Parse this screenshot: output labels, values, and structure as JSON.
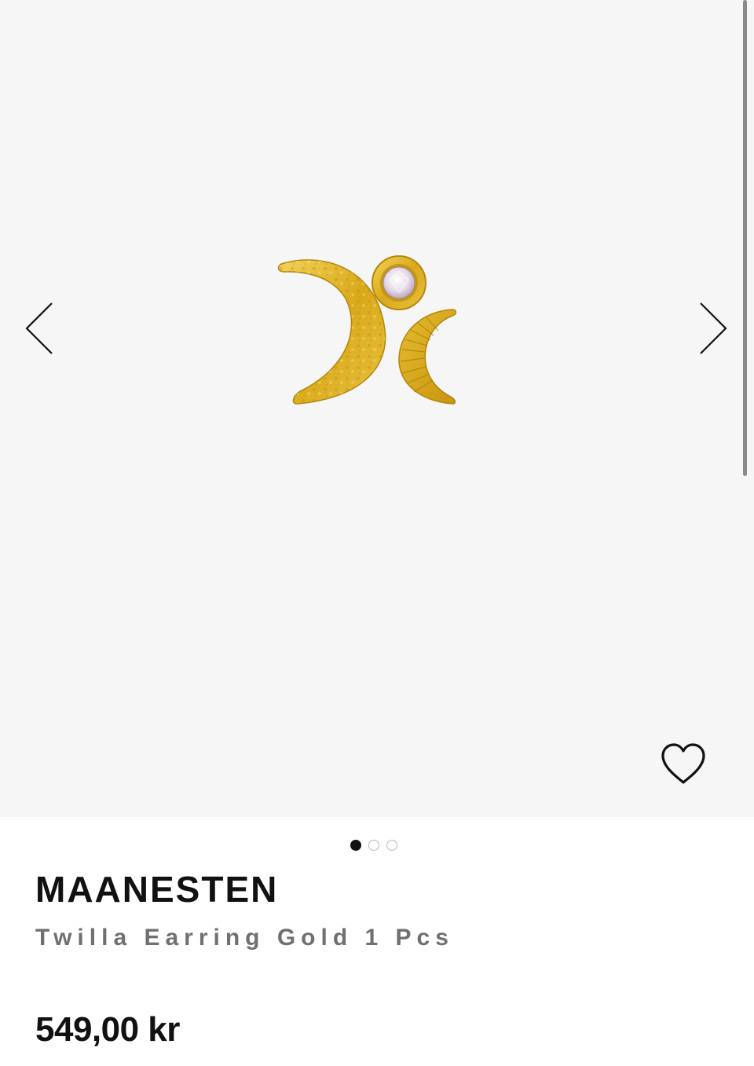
{
  "gallery": {
    "background_color": "#f6f6f6",
    "image_description_icon": "earring-moon-image",
    "prev_icon": "chevron-left-icon",
    "next_icon": "chevron-right-icon",
    "wishlist_icon": "heart-icon",
    "pagination": {
      "total": 3,
      "active_index": 0
    }
  },
  "product": {
    "brand": "MAANESTEN",
    "name": "Twilla Earring Gold 1 Pcs",
    "price": "549,00 kr"
  },
  "colors": {
    "text_primary": "#111111",
    "text_secondary": "#707070",
    "gold": "#d9a91a"
  }
}
